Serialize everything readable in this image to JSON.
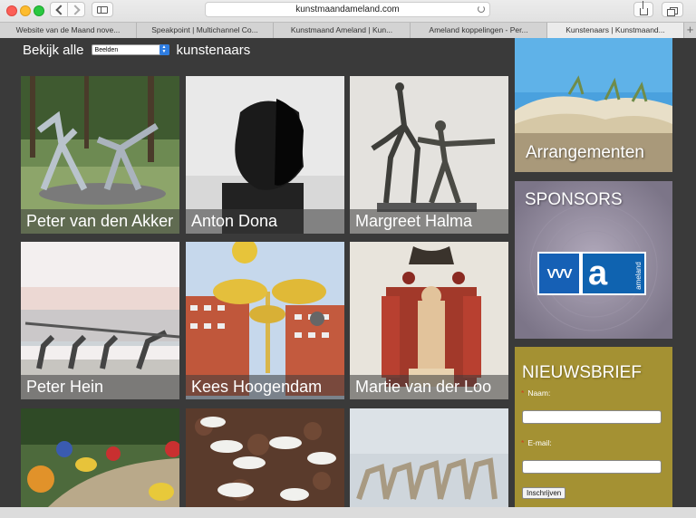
{
  "browser": {
    "url": "kunstmaandameland.com",
    "tabs": [
      {
        "label": "Website van de Maand nove..."
      },
      {
        "label": "Speakpoint | Multichannel Co..."
      },
      {
        "label": "Kunstmaand Ameland | Kun..."
      },
      {
        "label": "Ameland koppelingen - Per..."
      },
      {
        "label": "Kunstenaars | Kunstmaand..."
      }
    ],
    "new_tab": "+"
  },
  "filter": {
    "prefix": "Bekijk alle",
    "selected": "Beelden",
    "suffix": "kunstenaars"
  },
  "artists": [
    {
      "name": "Peter van den Akker"
    },
    {
      "name": "Anton Dona"
    },
    {
      "name": "Margreet Halma"
    },
    {
      "name": "Peter Hein"
    },
    {
      "name": "Kees Hoogendam"
    },
    {
      "name": "Martie van der Loo"
    },
    {
      "name": ""
    },
    {
      "name": ""
    },
    {
      "name": ""
    }
  ],
  "sidebar": {
    "arrangementen": "Arrangementen",
    "sponsors": "SPONSORS",
    "vvv_logo_text": "VVV",
    "ameland_logo_text": "ameland",
    "newsletter": {
      "title": "NIEUWSBRIEF",
      "name_label": "Naam:",
      "email_label": "E-mail:",
      "required_marker": "*",
      "submit": "Inschrijven"
    }
  },
  "colors": {
    "page_bg": "#3a3a3a",
    "newsletter_bg": "#a49133",
    "sponsor_bg": "#8c8598",
    "select_accent": "#2f7de1"
  }
}
